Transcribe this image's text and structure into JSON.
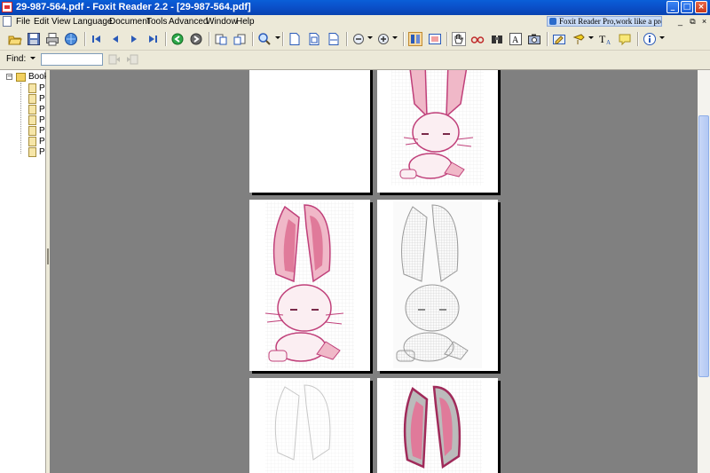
{
  "window": {
    "title": "29-987-564.pdf - Foxit Reader 2.2 - [29-987-564.pdf]",
    "minimize_glyph": "_",
    "maximize_glyph": "□",
    "close_glyph": "×"
  },
  "menu": {
    "items": [
      "File",
      "Edit",
      "View",
      "Language",
      "Document",
      "Tools",
      "Advanced",
      "Window",
      "Help"
    ],
    "promo_text": "Foxit Reader Pro,work like a pro!",
    "mdi_minimize": "_",
    "mdi_restore": "⧉",
    "mdi_close": "×"
  },
  "toolbar": {
    "icons": [
      "open-icon",
      "save-icon",
      "print-icon",
      "email-icon",
      "first-page-icon",
      "prev-page-icon",
      "next-page-icon",
      "last-page-icon",
      "go-back-icon",
      "go-forward-icon",
      "rotate-left-icon",
      "rotate-right-icon",
      "zoom-tool-icon",
      "actual-size-icon",
      "fit-page-icon",
      "fit-width-icon",
      "zoom-out-icon",
      "zoom-in-icon",
      "single-page-icon",
      "continuous-icon",
      "hand-tool-icon",
      "select-text-icon",
      "find-icon",
      "typewriter-icon",
      "snapshot-icon",
      "edit-annotation-icon",
      "highlight-icon",
      "text-tool-icon",
      "note-icon",
      "info-icon"
    ]
  },
  "find": {
    "label": "Find:",
    "value": ""
  },
  "bookmarks": {
    "root_label": "Book",
    "toggle": "−",
    "items": [
      "P",
      "P",
      "P",
      "P",
      "P",
      "P",
      "P"
    ]
  },
  "colors": {
    "doc_background": "#808080",
    "bunny_pink": "#f0b8c8",
    "bunny_outline": "#c0407a",
    "bunny_gray": "#bbbbbb"
  }
}
